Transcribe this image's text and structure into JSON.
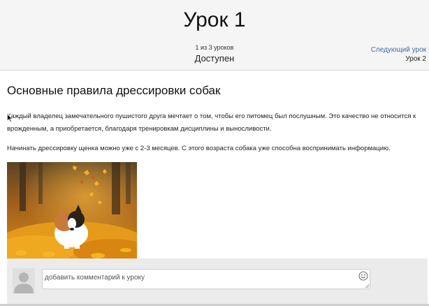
{
  "header": {
    "title": "Урок 1",
    "progress": "1 из 3 уроков",
    "status": "Доступен",
    "next_link_label": "Следующий урок",
    "next_lesson_name": "Урок 2",
    "link_color": "#3a6ea5"
  },
  "article": {
    "title": "Основные правила дрессировки собак",
    "paragraphs": [
      "Каждый владелец замечательного пушистого друга мечтает о том, чтобы его питомец был послушным. Это качество не относится к врожденным, а приобретается, благодаря тренировкам дисциплины и выносливости.",
      "Начинать дрессировку щенка можно уже с 2-3 месяцев. С этого возраста собака уже способна воспринимать информацию."
    ]
  },
  "comment": {
    "placeholder": "добавить комментарий к уроку",
    "value": ""
  },
  "icons": {
    "avatar": "user-avatar-icon",
    "emoji": "smiley-icon",
    "resize": "resize-handle-icon"
  }
}
